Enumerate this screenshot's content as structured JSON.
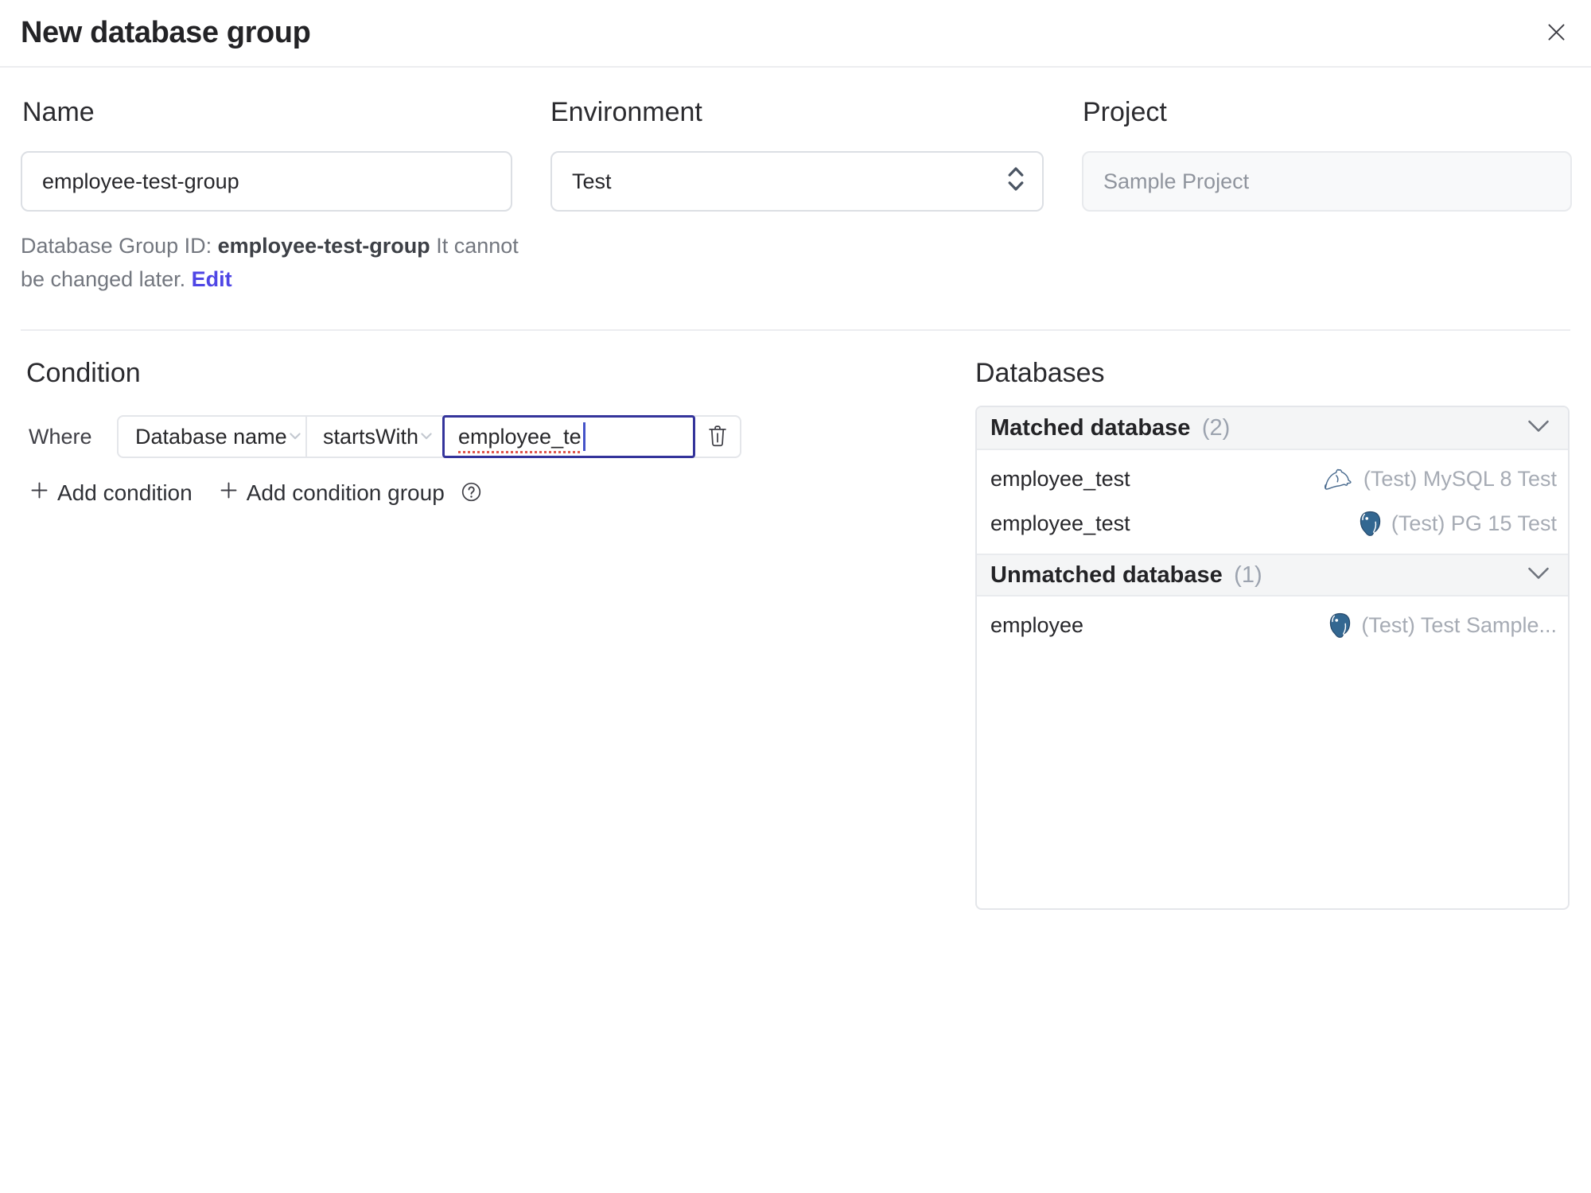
{
  "dialog": {
    "title": "New database group"
  },
  "form": {
    "name": {
      "label": "Name",
      "value": "employee-test-group"
    },
    "environment": {
      "label": "Environment",
      "value": "Test"
    },
    "project": {
      "label": "Project",
      "value": "Sample Project"
    },
    "id_hint": {
      "prefix": "Database Group ID: ",
      "id": "employee-test-group",
      "note": " It cannot be changed later. ",
      "edit_label": "Edit"
    }
  },
  "condition": {
    "heading": "Condition",
    "where_label": "Where",
    "factor": "Database name",
    "operator": "startsWith",
    "value": "employee_te",
    "add_condition_label": "Add condition",
    "add_condition_group_label": "Add condition group"
  },
  "databases": {
    "heading": "Databases",
    "sections": {
      "matched": {
        "label": "Matched database",
        "count": "(2)",
        "rows": [
          {
            "name": "employee_test",
            "engine": "mysql",
            "instance": "(Test) MySQL 8 Test"
          },
          {
            "name": "employee_test",
            "engine": "postgres",
            "instance": "(Test) PG 15 Test"
          }
        ]
      },
      "unmatched": {
        "label": "Unmatched database",
        "count": "(1)",
        "rows": [
          {
            "name": "employee",
            "engine": "postgres",
            "instance": "(Test) Test Sample..."
          }
        ]
      }
    }
  },
  "colors": {
    "accent_indigo": "#4f46e5",
    "focus_border": "#34349b",
    "mysql_icon": "#4a6b8f",
    "postgres_icon": "#336791",
    "spellcheck_underline": "#e0564d"
  }
}
